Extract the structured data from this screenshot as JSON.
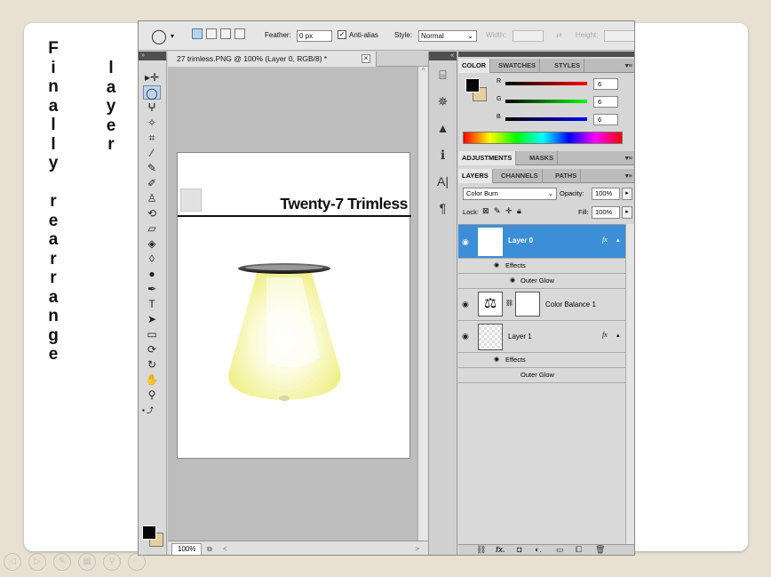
{
  "slide": {
    "heading_left": [
      "F",
      "i",
      "n",
      "a",
      "l",
      "l",
      "y",
      "",
      "r",
      "e",
      "a",
      "r",
      "r",
      "a",
      "n",
      "g",
      "e"
    ],
    "heading_right": [
      "l",
      "a",
      "y",
      "e",
      "r"
    ]
  },
  "options_bar": {
    "feather_label": "Feather:",
    "feather_value": "0 px",
    "antialias_label": "Anti-alias",
    "antialias_checked": true,
    "style_label": "Style:",
    "style_value": "Normal",
    "width_label": "Width:",
    "height_label": "Height:"
  },
  "document": {
    "tab_title": "27 trimless.PNG @ 100% (Layer 0, RGB/8) *",
    "canvas_heading": "Twenty-7 Trimless",
    "zoom": "100%"
  },
  "color_panel": {
    "tabs": [
      "COLOR",
      "SWATCHES",
      "STYLES"
    ],
    "channels": [
      {
        "label": "R",
        "value": "6"
      },
      {
        "label": "G",
        "value": "6"
      },
      {
        "label": "B",
        "value": "6"
      }
    ]
  },
  "adjustments_panel": {
    "tabs": [
      "ADJUSTMENTS",
      "MASKS"
    ]
  },
  "layers_panel": {
    "tabs": [
      "LAYERS",
      "CHANNELS",
      "PATHS"
    ],
    "blend_mode": "Color Burn",
    "opacity_label": "Opacity:",
    "opacity_value": "100%",
    "lock_label": "Lock:",
    "fill_label": "Fill:",
    "fill_value": "100%",
    "layers": [
      {
        "name": "Layer 0",
        "effects_label": "Effects",
        "effect": "Outer Glow",
        "selected": true
      },
      {
        "name": "Color Balance 1"
      },
      {
        "name": "Layer 1",
        "effects_label": "Effects",
        "effect": "Outer Glow",
        "selected": false
      }
    ]
  },
  "colors": {
    "accent": "#3c8fd6",
    "slide_bg": "#e8e1d3",
    "bulb_glow": "#f3f38a"
  }
}
